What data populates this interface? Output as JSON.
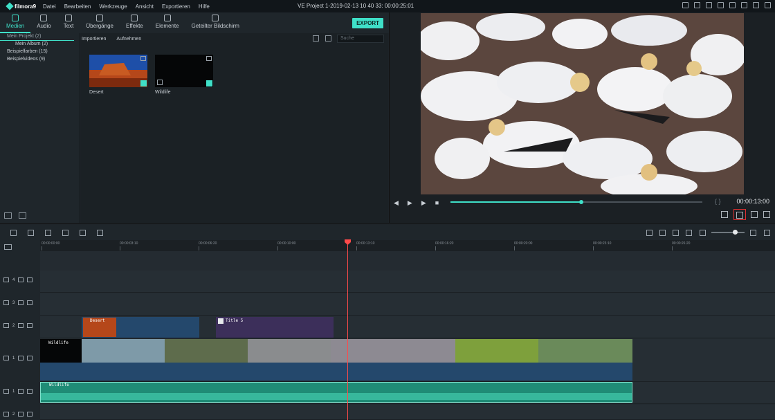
{
  "app": {
    "logo": "filmora9",
    "menu": [
      "Datei",
      "Bearbeiten",
      "Werkzeuge",
      "Ansicht",
      "Exportieren",
      "Hilfe"
    ],
    "window_title": "VE Project 1-2019-02-13 10 40 33:  00:00:25:01"
  },
  "tabs": [
    {
      "label": "Medien",
      "icon": "folder-icon"
    },
    {
      "label": "Audio",
      "icon": "music-note-icon"
    },
    {
      "label": "Text",
      "icon": "text-icon"
    },
    {
      "label": "Übergänge",
      "icon": "transition-icon"
    },
    {
      "label": "Effekte",
      "icon": "effects-icon"
    },
    {
      "label": "Elemente",
      "icon": "image-icon"
    },
    {
      "label": "Geteilter Bildschirm",
      "icon": "split-screen-icon"
    }
  ],
  "export_label": "EXPORT",
  "library": {
    "items": [
      {
        "label": "Mein Projekt (2)"
      },
      {
        "label": "Mein Album (2)"
      },
      {
        "label": "Beispielfarben (15)"
      },
      {
        "label": "Beispielvideos (9)"
      }
    ]
  },
  "media": {
    "import_label": "Importieren",
    "record_label": "Aufnehmen",
    "search_placeholder": "Suche",
    "items": [
      {
        "label": "Desert"
      },
      {
        "label": "Wildlife"
      }
    ]
  },
  "preview": {
    "timecode": "00:00:13:00",
    "progress_fraction": 0.52,
    "brackets": "{   }"
  },
  "timeline": {
    "ruler": [
      "00:00:00:00",
      "00:00:03:10",
      "00:00:06:20",
      "00:00:10:00",
      "00:00:13:10",
      "00:00:16:20",
      "00:00:20:00",
      "00:00:23:10",
      "00:00:26:20"
    ],
    "tracks": [
      {
        "label": "4",
        "type": "video"
      },
      {
        "label": "3",
        "type": "video"
      },
      {
        "label": "2",
        "type": "video"
      },
      {
        "label": "1",
        "type": "video"
      },
      {
        "label": "1",
        "type": "audio"
      },
      {
        "label": "2",
        "type": "audio"
      }
    ],
    "clips": {
      "desert": "Desert",
      "title": "Title 5",
      "wildlife_video": "Wildlife",
      "wildlife_audio": "Wildlife"
    }
  },
  "colors": {
    "accent": "#3fe0c8",
    "playhead": "#ff4a4a",
    "title_clip": "#3c2f5a",
    "video_clip": "#24486c",
    "audio_clip": "#1f8c76"
  }
}
